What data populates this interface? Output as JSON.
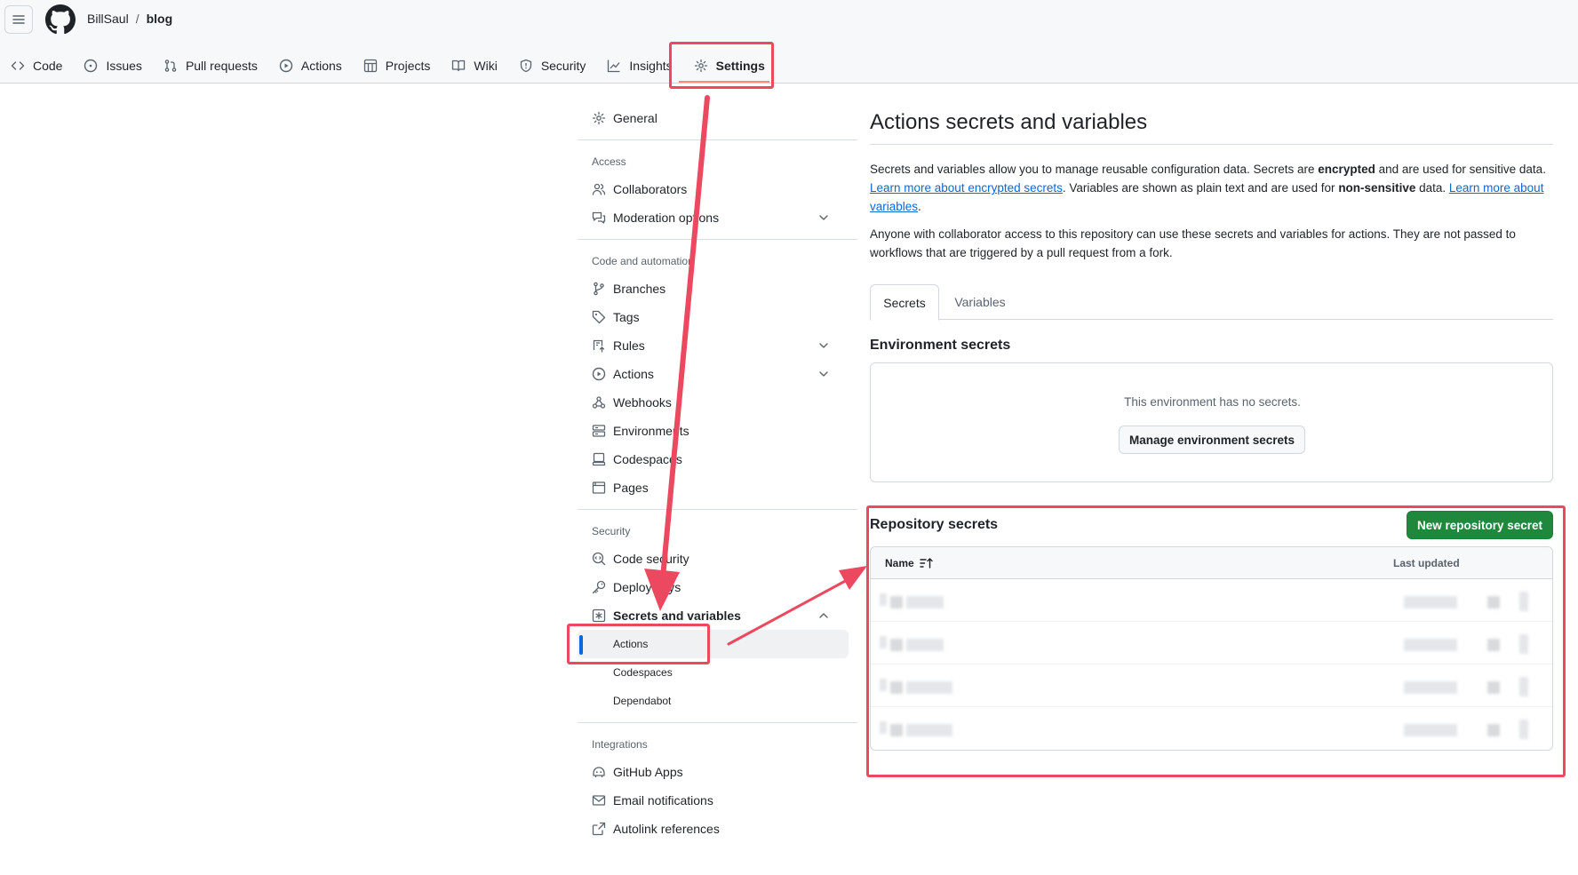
{
  "header": {
    "owner": "BillSaul",
    "separator": "/",
    "repo": "blog"
  },
  "repo_tabs": [
    {
      "label": "Code",
      "icon": "code-icon"
    },
    {
      "label": "Issues",
      "icon": "issue-icon"
    },
    {
      "label": "Pull requests",
      "icon": "pull-request-icon"
    },
    {
      "label": "Actions",
      "icon": "actions-icon"
    },
    {
      "label": "Projects",
      "icon": "projects-icon"
    },
    {
      "label": "Wiki",
      "icon": "book-icon"
    },
    {
      "label": "Security",
      "icon": "shield-icon"
    },
    {
      "label": "Insights",
      "icon": "graph-icon"
    },
    {
      "label": "Settings",
      "icon": "gear-icon",
      "selected": true
    }
  ],
  "sidebar": {
    "general": "General",
    "access_heading": "Access",
    "collaborators": "Collaborators",
    "moderation": "Moderation options",
    "code_heading": "Code and automation",
    "branches": "Branches",
    "tags": "Tags",
    "rules": "Rules",
    "actions": "Actions",
    "webhooks": "Webhooks",
    "environments": "Environments",
    "codespaces": "Codespaces",
    "pages": "Pages",
    "security_heading": "Security",
    "code_security": "Code security",
    "deploy_keys": "Deploy keys",
    "secrets_vars": "Secrets and variables",
    "sub_actions": "Actions",
    "sub_codespaces": "Codespaces",
    "sub_dependabot": "Dependabot",
    "integrations_heading": "Integrations",
    "github_apps": "GitHub Apps",
    "email_notifications": "Email notifications",
    "autolink": "Autolink references"
  },
  "main": {
    "title": "Actions secrets and variables",
    "desc_1": "Secrets and variables allow you to manage reusable configuration data. Secrets are ",
    "desc_bold_1": "encrypted",
    "desc_2": " and are used for sensitive data. ",
    "desc_link_1": "Learn more about encrypted secrets",
    "desc_3": ". Variables are shown as plain text and are used for ",
    "desc_bold_2": "non-sensitive",
    "desc_4": " data. ",
    "desc_link_2": "Learn more about variables",
    "desc_5": ".",
    "desc_second": "Anyone with collaborator access to this repository can use these secrets and variables for actions. They are not passed to workflows that are triggered by a pull request from a fork.",
    "tab_secrets": "Secrets",
    "tab_variables": "Variables",
    "env_heading": "Environment secrets",
    "env_empty": "This environment has no secrets.",
    "manage_env_btn": "Manage environment secrets",
    "repo_heading": "Repository secrets",
    "new_secret_btn": "New repository secret",
    "col_name": "Name",
    "col_updated": "Last updated"
  },
  "colors": {
    "accent": "#0969da",
    "primary_button": "#1f883d",
    "annotation": "#ec4960",
    "tab_underline": "#fd8c73"
  }
}
